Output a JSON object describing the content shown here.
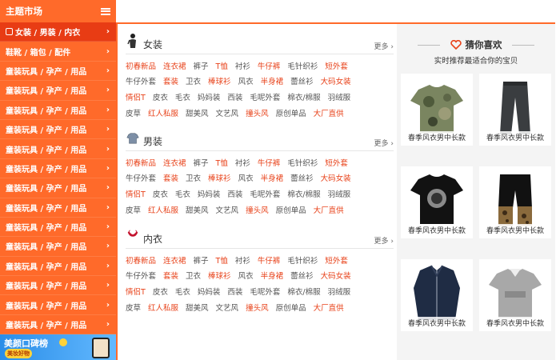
{
  "sidebar": {
    "title": "主题市场",
    "items": [
      {
        "label": "女装 / 男装 / 内衣",
        "active": true
      },
      {
        "label": "鞋靴 / 箱包 / 配件",
        "active": false
      },
      {
        "label": "童装玩具 / 孕产 / 用品",
        "active": false
      },
      {
        "label": "童装玩具 / 孕产 / 用品",
        "active": false
      },
      {
        "label": "童装玩具 / 孕产 / 用品",
        "active": false
      },
      {
        "label": "童装玩具 / 孕产 / 用品",
        "active": false
      },
      {
        "label": "童装玩具 / 孕产 / 用品",
        "active": false
      },
      {
        "label": "童装玩具 / 孕产 / 用品",
        "active": false
      },
      {
        "label": "童装玩具 / 孕产 / 用品",
        "active": false
      },
      {
        "label": "童装玩具 / 孕产 / 用品",
        "active": false
      },
      {
        "label": "童装玩具 / 孕产 / 用品",
        "active": false
      },
      {
        "label": "童装玩具 / 孕产 / 用品",
        "active": false
      },
      {
        "label": "童装玩具 / 孕产 / 用品",
        "active": false
      },
      {
        "label": "童装玩具 / 孕产 / 用品",
        "active": false
      },
      {
        "label": "童装玩具 / 孕产 / 用品",
        "active": false
      },
      {
        "label": "童装玩具 / 孕产 / 用品",
        "active": false
      }
    ],
    "banner": {
      "title": "美颜口碑榜",
      "sub": "美妆好物"
    }
  },
  "sections": [
    {
      "title": "女装",
      "more": "更多 ›",
      "rows": [
        [
          {
            "t": "初春新品",
            "hl": true
          },
          {
            "t": "连衣裙",
            "hl": true
          },
          {
            "t": "裤子",
            "hl": false
          },
          {
            "t": "T恤",
            "hl": true
          },
          {
            "t": "衬衫",
            "hl": false
          },
          {
            "t": "牛仔裤",
            "hl": true
          },
          {
            "t": "毛针织衫",
            "hl": false
          },
          {
            "t": "短外套",
            "hl": true
          }
        ],
        [
          {
            "t": "牛仔外套",
            "hl": false
          },
          {
            "t": "套装",
            "hl": true
          },
          {
            "t": "卫衣",
            "hl": false
          },
          {
            "t": "棒球衫",
            "hl": true
          },
          {
            "t": "风衣",
            "hl": false
          },
          {
            "t": "半身裙",
            "hl": true
          },
          {
            "t": "蕾丝衫",
            "hl": false
          },
          {
            "t": "大码女装",
            "hl": true
          }
        ],
        [
          {
            "t": "情侣T",
            "hl": true
          },
          {
            "t": "皮衣",
            "hl": false
          },
          {
            "t": "毛衣",
            "hl": false
          },
          {
            "t": "妈妈装",
            "hl": false
          },
          {
            "t": "西装",
            "hl": false
          },
          {
            "t": "毛呢外套",
            "hl": false
          },
          {
            "t": "棉衣/棉服",
            "hl": false
          },
          {
            "t": "羽绒服",
            "hl": false
          }
        ],
        [
          {
            "t": "皮草",
            "hl": false
          },
          {
            "t": "红人私服",
            "hl": true
          },
          {
            "t": "甜美风",
            "hl": false
          },
          {
            "t": "文艺风",
            "hl": false
          },
          {
            "t": "撞头风",
            "hl": true
          },
          {
            "t": "原创单品",
            "hl": false
          },
          {
            "t": "大厂直供",
            "hl": true
          }
        ]
      ]
    },
    {
      "title": "男装",
      "more": "更多 ›",
      "rows": [
        [
          {
            "t": "初春新品",
            "hl": true
          },
          {
            "t": "连衣裙",
            "hl": true
          },
          {
            "t": "裤子",
            "hl": false
          },
          {
            "t": "T恤",
            "hl": true
          },
          {
            "t": "衬衫",
            "hl": false
          },
          {
            "t": "牛仔裤",
            "hl": true
          },
          {
            "t": "毛针织衫",
            "hl": false
          },
          {
            "t": "短外套",
            "hl": true
          }
        ],
        [
          {
            "t": "牛仔外套",
            "hl": false
          },
          {
            "t": "套装",
            "hl": true
          },
          {
            "t": "卫衣",
            "hl": false
          },
          {
            "t": "棒球衫",
            "hl": true
          },
          {
            "t": "风衣",
            "hl": false
          },
          {
            "t": "半身裙",
            "hl": true
          },
          {
            "t": "蕾丝衫",
            "hl": false
          },
          {
            "t": "大码女装",
            "hl": true
          }
        ],
        [
          {
            "t": "情侣T",
            "hl": true
          },
          {
            "t": "皮衣",
            "hl": false
          },
          {
            "t": "毛衣",
            "hl": false
          },
          {
            "t": "妈妈装",
            "hl": false
          },
          {
            "t": "西装",
            "hl": false
          },
          {
            "t": "毛呢外套",
            "hl": false
          },
          {
            "t": "棉衣/棉服",
            "hl": false
          },
          {
            "t": "羽绒服",
            "hl": false
          }
        ],
        [
          {
            "t": "皮草",
            "hl": false
          },
          {
            "t": "红人私服",
            "hl": true
          },
          {
            "t": "甜美风",
            "hl": false
          },
          {
            "t": "文艺风",
            "hl": false
          },
          {
            "t": "撞头风",
            "hl": true
          },
          {
            "t": "原创单品",
            "hl": false
          },
          {
            "t": "大厂直供",
            "hl": true
          }
        ]
      ]
    },
    {
      "title": "内衣",
      "more": "更多 ›",
      "rows": [
        [
          {
            "t": "初春新品",
            "hl": true
          },
          {
            "t": "连衣裙",
            "hl": true
          },
          {
            "t": "裤子",
            "hl": false
          },
          {
            "t": "T恤",
            "hl": true
          },
          {
            "t": "衬衫",
            "hl": false
          },
          {
            "t": "牛仔裤",
            "hl": true
          },
          {
            "t": "毛针织衫",
            "hl": false
          },
          {
            "t": "短外套",
            "hl": true
          }
        ],
        [
          {
            "t": "牛仔外套",
            "hl": false
          },
          {
            "t": "套装",
            "hl": true
          },
          {
            "t": "卫衣",
            "hl": false
          },
          {
            "t": "棒球衫",
            "hl": true
          },
          {
            "t": "风衣",
            "hl": false
          },
          {
            "t": "半身裙",
            "hl": true
          },
          {
            "t": "蕾丝衫",
            "hl": false
          },
          {
            "t": "大码女装",
            "hl": true
          }
        ],
        [
          {
            "t": "情侣T",
            "hl": true
          },
          {
            "t": "皮衣",
            "hl": false
          },
          {
            "t": "毛衣",
            "hl": false
          },
          {
            "t": "妈妈装",
            "hl": false
          },
          {
            "t": "西装",
            "hl": false
          },
          {
            "t": "毛呢外套",
            "hl": false
          },
          {
            "t": "棉衣/棉服",
            "hl": false
          },
          {
            "t": "羽绒服",
            "hl": false
          }
        ],
        [
          {
            "t": "皮草",
            "hl": false
          },
          {
            "t": "红人私服",
            "hl": true
          },
          {
            "t": "甜美风",
            "hl": false
          },
          {
            "t": "文艺风",
            "hl": false
          },
          {
            "t": "撞头风",
            "hl": true
          },
          {
            "t": "原创单品",
            "hl": false
          },
          {
            "t": "大厂直供",
            "hl": true
          }
        ]
      ]
    }
  ],
  "rec": {
    "title": "猜你喜欢",
    "subtitle": "实时推荐最适合你的宝贝",
    "items": [
      {
        "caption": "春季风衣男中长款",
        "kind": "camo-tshirt"
      },
      {
        "caption": "春季风衣男中长款",
        "kind": "dark-pants"
      },
      {
        "caption": "春季风衣男中长款",
        "kind": "black-tshirt"
      },
      {
        "caption": "春季风衣男中长款",
        "kind": "shorts"
      },
      {
        "caption": "春季风衣男中长款",
        "kind": "navy-jacket"
      },
      {
        "caption": "春季风衣男中长款",
        "kind": "grey-polo"
      }
    ]
  },
  "colors": {
    "accent": "#ff6a2a",
    "accent_dark": "#e83c14",
    "highlight": "#e8431b"
  }
}
